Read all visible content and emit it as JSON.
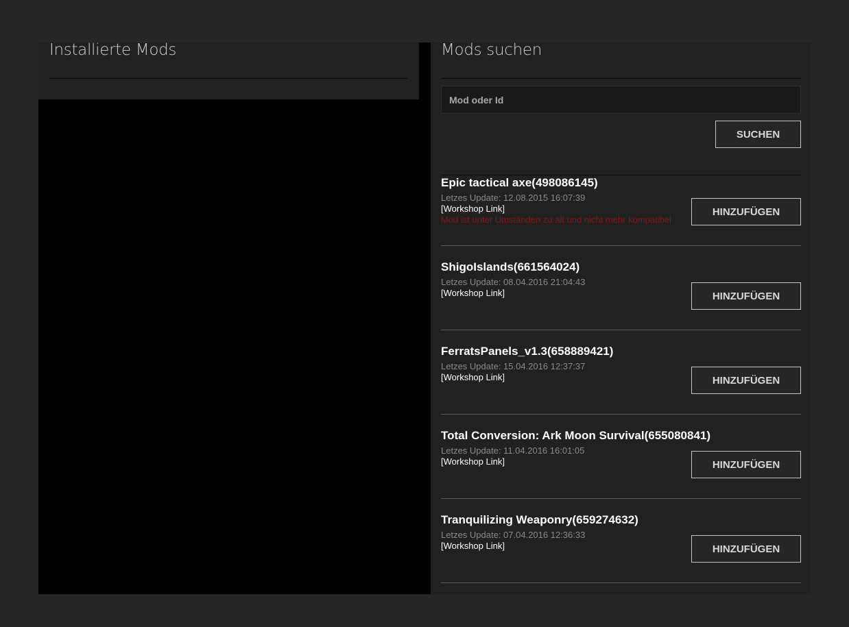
{
  "installed": {
    "title": "Installierte Mods"
  },
  "search": {
    "title": "Mods suchen",
    "placeholder": "Mod oder Id",
    "button_label": "SUCHEN"
  },
  "results": [
    {
      "title": "Epic tactical axe(498086145)",
      "update": "Letzes Update: 12.08.2015 16:07:39",
      "link": "[Workshop Link]",
      "warning": "Mod ist unter Umständen zu alt und nicht mehr kompatibel",
      "button": "HINZUFÜGEN"
    },
    {
      "title": "ShigoIslands(661564024)",
      "update": "Letzes Update: 08.04.2016 21:04:43",
      "link": "[Workshop Link]",
      "button": "HINZUFÜGEN"
    },
    {
      "title": "FerratsPanels_v1.3(658889421)",
      "update": "Letzes Update: 15.04.2016 12:37:37",
      "link": "[Workshop Link]",
      "button": "HINZUFÜGEN"
    },
    {
      "title": "Total Conversion: Ark Moon Survival(655080841)",
      "update": "Letzes Update: 11.04.2016 16:01:05",
      "link": "[Workshop Link]",
      "button": "HINZUFÜGEN"
    },
    {
      "title": "Tranquilizing Weaponry(659274632)",
      "update": "Letzes Update: 07.04.2016 12:36:33",
      "link": "[Workshop Link]",
      "button": "HINZUFÜGEN"
    }
  ],
  "colors": {
    "page_bg": "#262626",
    "panel_bg": "#212121",
    "installed_list_bg": "#000000",
    "warning": "#7a1a1a",
    "muted_text": "#8a8a8a"
  }
}
